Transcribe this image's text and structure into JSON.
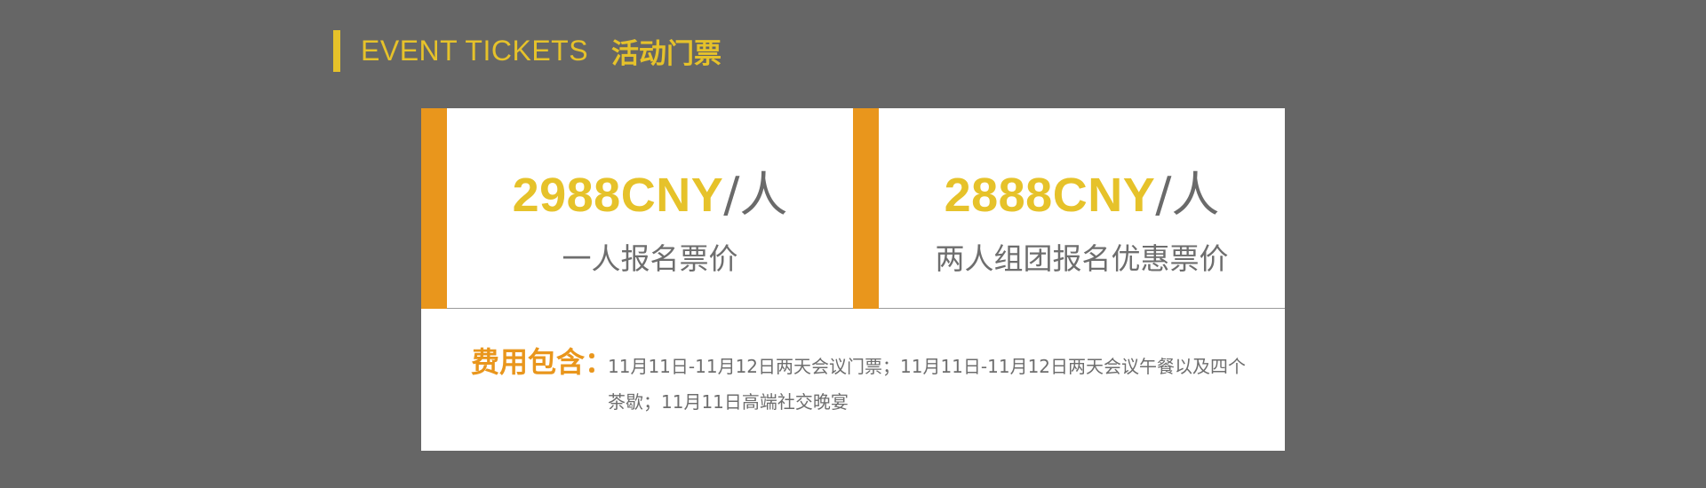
{
  "header": {
    "title_en": "EVENT TICKETS",
    "title_cn": "活动门票",
    "accent_color": "#e6c22a"
  },
  "tickets": [
    {
      "price": "2988CNY",
      "unit": "/人",
      "description": "一人报名票价"
    },
    {
      "price": "2888CNY",
      "unit": "/人",
      "description": "两人组团报名优惠票价"
    }
  ],
  "includes": {
    "label": "费用包含：",
    "line1": "11月11日-11月12日两天会议门票；11月11日-11月12日两天会议午餐以及四个",
    "line2": "茶歇；11月11日高端社交晚宴"
  },
  "colors": {
    "background": "#666666",
    "panel": "#ffffff",
    "price": "#e6c22a",
    "accent_strip": "#e9961c",
    "includes_label": "#e9961c",
    "text": "#6e6e6e"
  }
}
